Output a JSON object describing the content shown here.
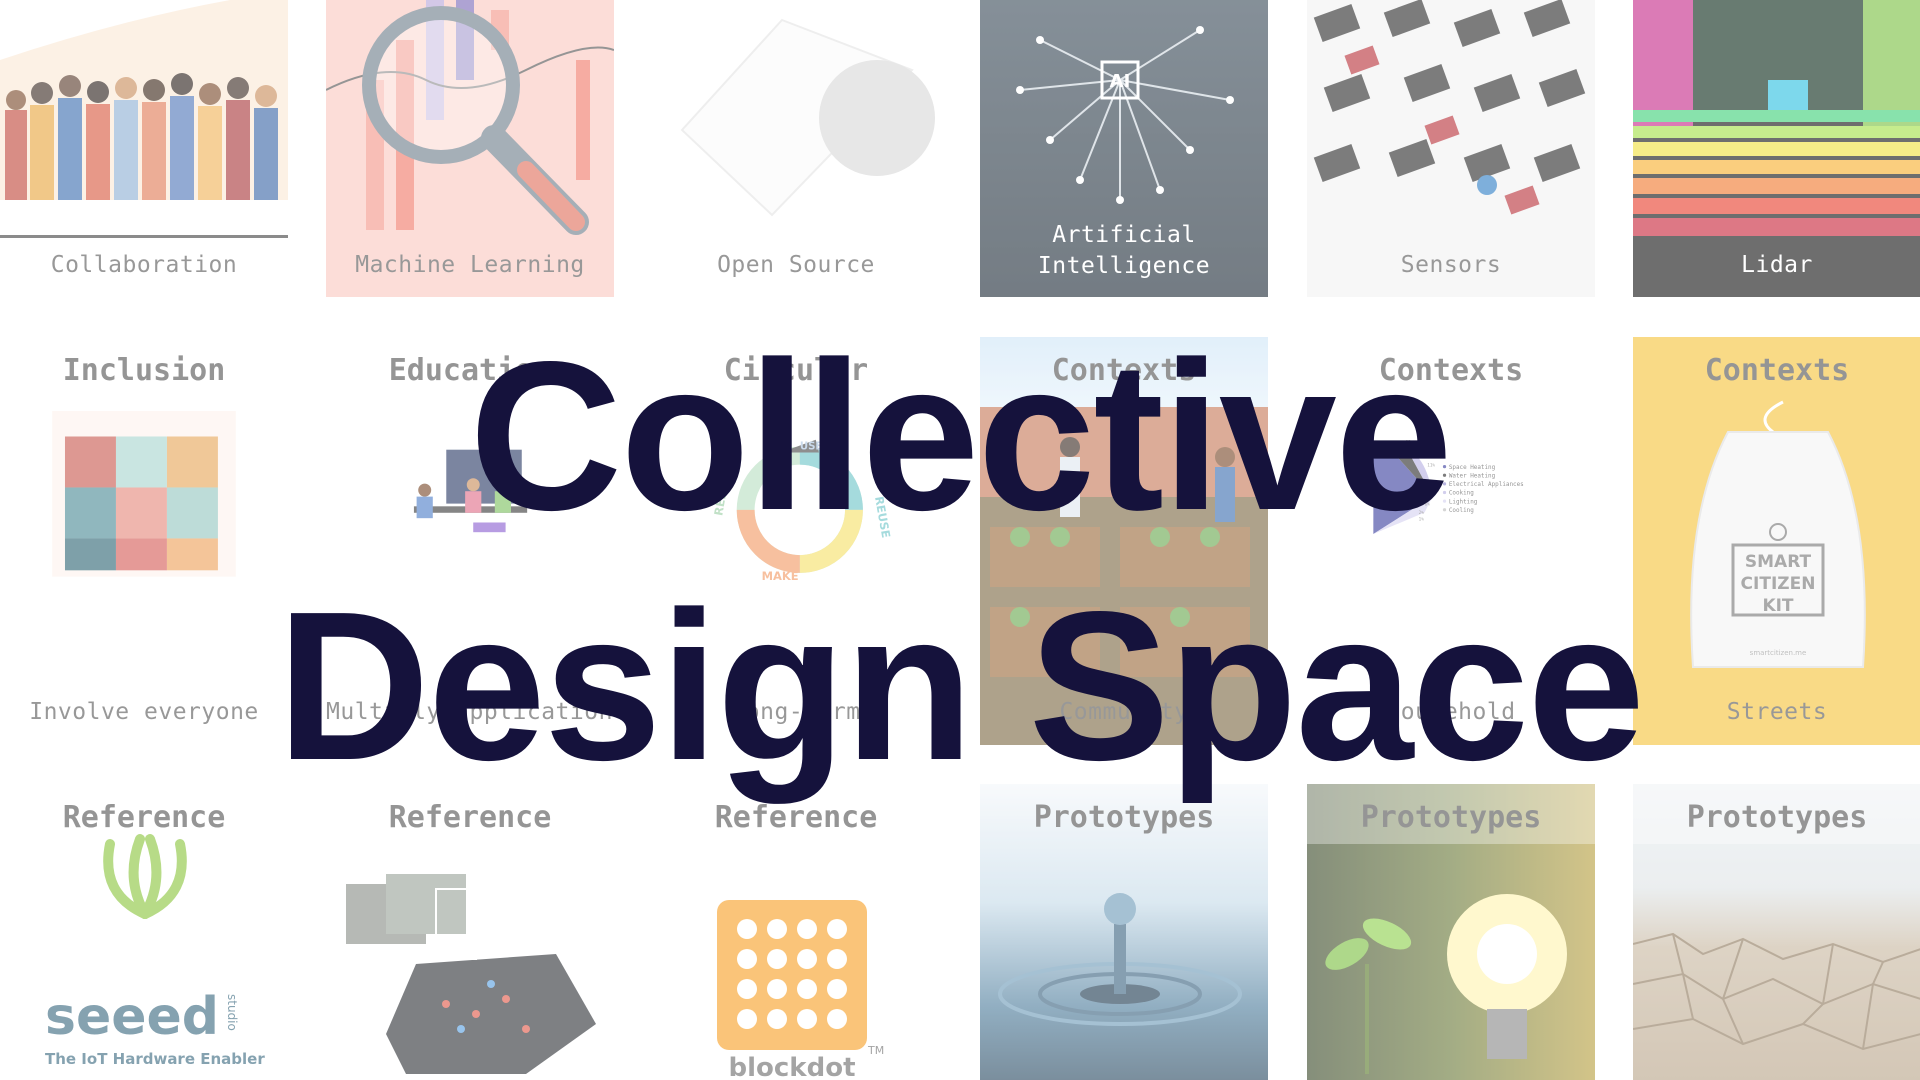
{
  "title": {
    "line1": "Collective",
    "line2": "Design Space"
  },
  "row1": [
    {
      "label": "Collaboration"
    },
    {
      "label": "Machine Learning"
    },
    {
      "label": "Open Source"
    },
    {
      "label": "Artificial\nIntelligence"
    },
    {
      "label": "Sensors"
    },
    {
      "label": "Lidar"
    }
  ],
  "row2": [
    {
      "header": "Inclusion",
      "label": "Involve everyone"
    },
    {
      "header": "Education",
      "label": "Multiply applications"
    },
    {
      "header": "Circular",
      "label": "Long-term"
    },
    {
      "header": "Contexts",
      "label": "Community"
    },
    {
      "header": "Contexts",
      "label": "Household"
    },
    {
      "header": "Contexts",
      "label": "Streets"
    }
  ],
  "row3": [
    {
      "header": "Reference"
    },
    {
      "header": "Reference"
    },
    {
      "header": "Reference"
    },
    {
      "header": "Prototypes"
    },
    {
      "header": "Prototypes"
    },
    {
      "header": "Prototypes"
    }
  ],
  "chart_legend": [
    "Space Heating",
    "Water Heating",
    "Electrical Appliances",
    "Cooking",
    "Lighting",
    "Cooling"
  ],
  "chart_pcts": [
    "13%",
    "11%",
    "6%",
    "2%",
    "1%"
  ],
  "circular_words": [
    "REDESIGN",
    "REUSE",
    "MAKE",
    "USE"
  ],
  "ai_chip": "AI",
  "kit_text": [
    "SMART",
    "CITIZEN",
    "KIT"
  ],
  "kit_url": "smartcitizen.me",
  "seeed": {
    "name": "seeed",
    "studio": "studio",
    "tagline": "The IoT Hardware Enabler"
  },
  "blockdot": {
    "name": "blockdot",
    "tm": "TM"
  },
  "colors": {
    "title": "#15123c",
    "accent_orange": "#f7a128",
    "kit_bg": "#f6c33c",
    "seeed_green": "#8cc63e"
  }
}
